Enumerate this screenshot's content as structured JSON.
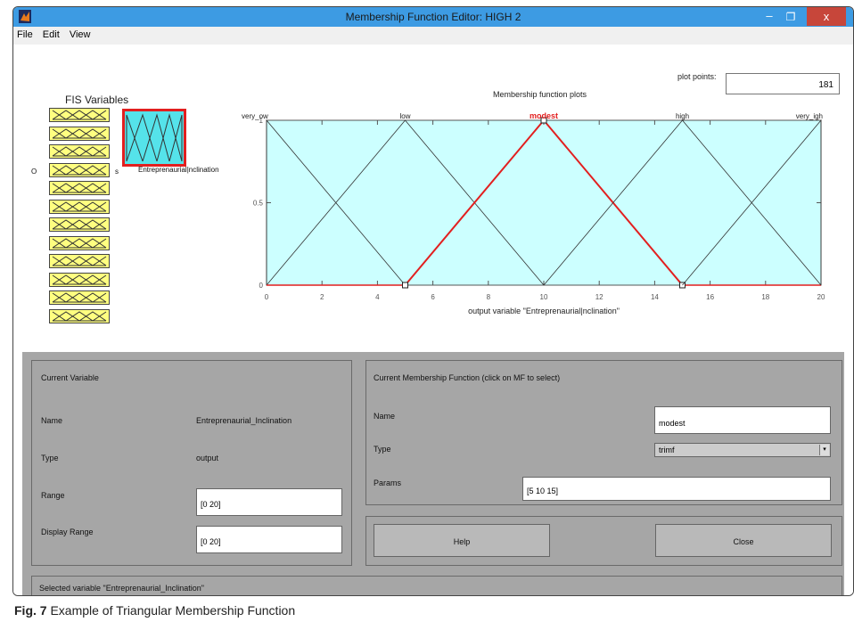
{
  "window": {
    "title": "Membership Function Editor: HIGH 2",
    "minimize": "–",
    "maximize": "❐",
    "close": "x",
    "app_icon": "matlab-icon"
  },
  "menubar": [
    "File",
    "Edit",
    "View"
  ],
  "fis": {
    "title": "FIS Variables",
    "selected_variable": "Entreprenaurial_Inclination",
    "selected_variable_label": "Entreprenaurial|nclination",
    "input_box_count": 12
  },
  "plot": {
    "title": "Membership function plots",
    "plot_points_label": "plot points:",
    "plot_points_value": "181",
    "xlabel": "output variable \"Entreprenaurial|nclination\"",
    "mf_labels": [
      "very_ow",
      "low",
      "modest",
      "high",
      "very_igh"
    ],
    "selected_mf": "modest",
    "colors": {
      "background": "#ccffff",
      "selected": "#e21f1f",
      "line": "#333333"
    }
  },
  "chart_data": {
    "type": "line",
    "xlim": [
      0,
      20
    ],
    "ylim": [
      0,
      1
    ],
    "x_ticks": [
      "0",
      "2",
      "4",
      "6",
      "8",
      "10",
      "12",
      "14",
      "16",
      "18",
      "20"
    ],
    "y_ticks": [
      "0",
      "0.5",
      "1"
    ],
    "series": [
      {
        "name": "very_ow",
        "x": [
          0,
          0,
          5
        ],
        "y": [
          0,
          1,
          0
        ]
      },
      {
        "name": "low",
        "x": [
          0,
          5,
          10
        ],
        "y": [
          0,
          1,
          0
        ]
      },
      {
        "name": "modest",
        "x": [
          5,
          10,
          15
        ],
        "y": [
          0,
          1,
          0
        ]
      },
      {
        "name": "high",
        "x": [
          10,
          15,
          20
        ],
        "y": [
          0,
          1,
          0
        ]
      },
      {
        "name": "very_igh",
        "x": [
          15,
          20,
          20
        ],
        "y": [
          0,
          1,
          0
        ]
      }
    ]
  },
  "current_variable": {
    "header": "Current Variable",
    "name_label": "Name",
    "name_value": "Entreprenaurial_Inclination",
    "type_label": "Type",
    "type_value": "output",
    "range_label": "Range",
    "range_value": "[0 20]",
    "display_range_label": "Display Range",
    "display_range_value": "[0 20]"
  },
  "current_mf": {
    "header": "Current Membership Function (click on MF to select)",
    "name_label": "Name",
    "name_value": "modest",
    "type_label": "Type",
    "type_value": "trimf",
    "params_label": "Params",
    "params_value": "[5 10 15]"
  },
  "buttons": {
    "help": "Help",
    "close": "Close"
  },
  "status": "Selected variable \"Entreprenaurial_Inclination\"",
  "caption": {
    "prefix": "Fig. 7",
    "text": " Example of Triangular Membership Function"
  }
}
